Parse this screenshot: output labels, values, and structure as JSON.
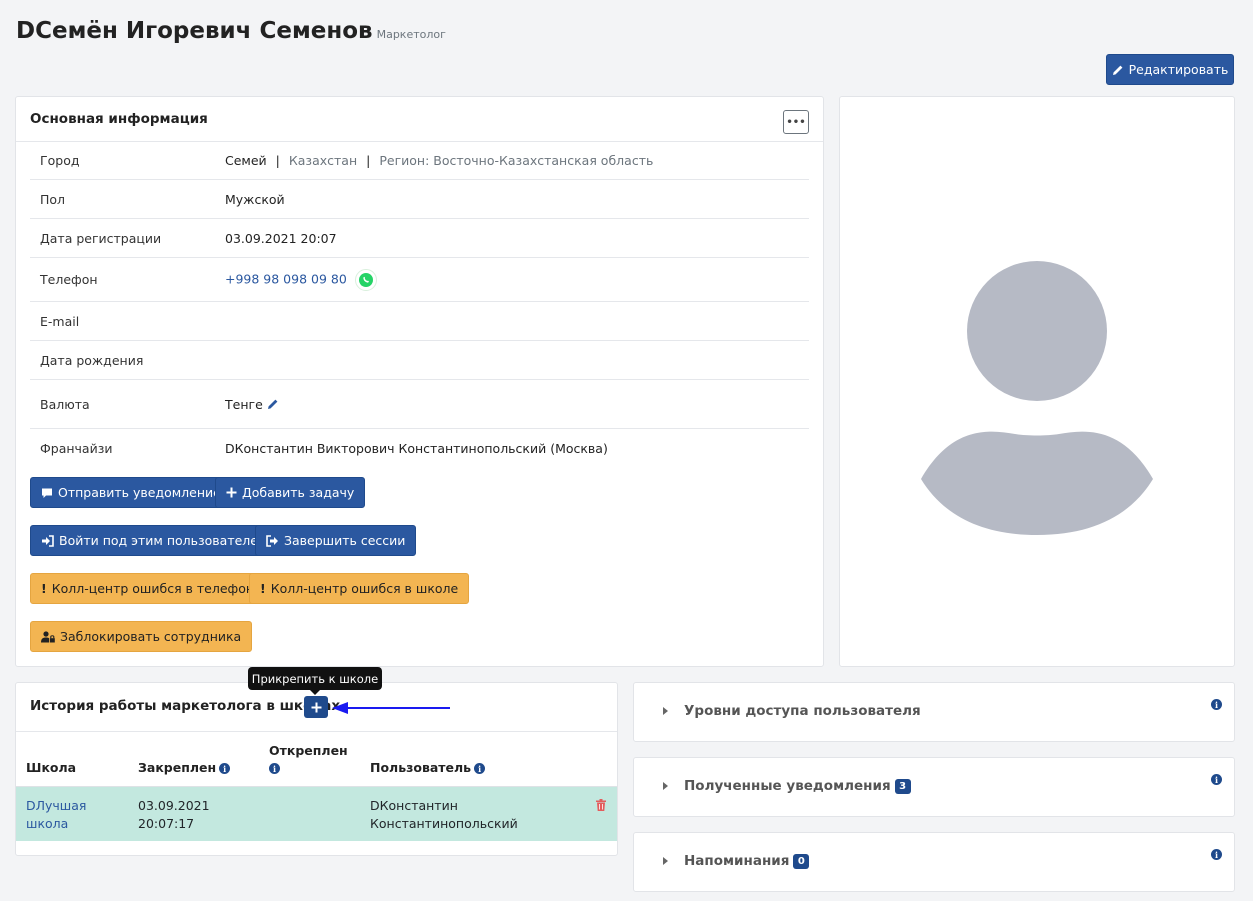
{
  "header": {
    "name": "DСемён Игоревич Семенов",
    "role": "Маркетолог",
    "edit_label": "Редактировать"
  },
  "info_card": {
    "title": "Основная информация",
    "rows": {
      "city": {
        "label": "Город",
        "city": "Семей",
        "country": "Казахстан",
        "region": "Регион: Восточно-Казахстанская область"
      },
      "gender": {
        "label": "Пол",
        "value": "Мужской"
      },
      "reg_date": {
        "label": "Дата регистрации",
        "value": "03.09.2021 20:07"
      },
      "phone": {
        "label": "Телефон",
        "value": "+998 98 098 09 80"
      },
      "email": {
        "label": "E-mail",
        "value": ""
      },
      "birth": {
        "label": "Дата рождения",
        "value": ""
      },
      "currency": {
        "label": "Валюта",
        "value": "Тенге"
      },
      "franchisee": {
        "label": "Франчайзи",
        "value": "DКонстантин Викторович Константинопольский (Москва)"
      }
    },
    "buttons": {
      "send_notification": "Отправить уведомление",
      "add_task": "Добавить задачу",
      "login_as": "Войти под этим пользователем",
      "end_sessions": "Завершить сессии",
      "callcenter_phone": "Колл-центр ошибся в телефоне",
      "callcenter_school": "Колл-центр ошибся в школе",
      "block_employee": "Заблокировать сотрудника"
    }
  },
  "history": {
    "title": "История работы маркетолога в школах",
    "tooltip": "Прикрепить к школе",
    "columns": {
      "school": "Школа",
      "attached": "Закреплен",
      "detached": "Откреплен",
      "user": "Пользователь"
    },
    "rows": [
      {
        "school_l1": "DЛучшая",
        "school_l2": "школа",
        "date": "03.09.2021",
        "time": "20:07:17",
        "detached": "",
        "user_l1": "DКонстантин",
        "user_l2": "Константинопольский"
      }
    ]
  },
  "accordions": [
    {
      "title": "Уровни доступа пользователя",
      "badge": ""
    },
    {
      "title": "Полученные уведомления",
      "badge": "3"
    },
    {
      "title": "Напоминания",
      "badge": "0"
    }
  ],
  "colors": {
    "primary": "#2b58a0",
    "warning": "#f3b552",
    "row_highlight": "#c3e8df",
    "danger": "#e35d5d",
    "whatsapp": "#25d366",
    "avatar": "#b6bac5"
  }
}
